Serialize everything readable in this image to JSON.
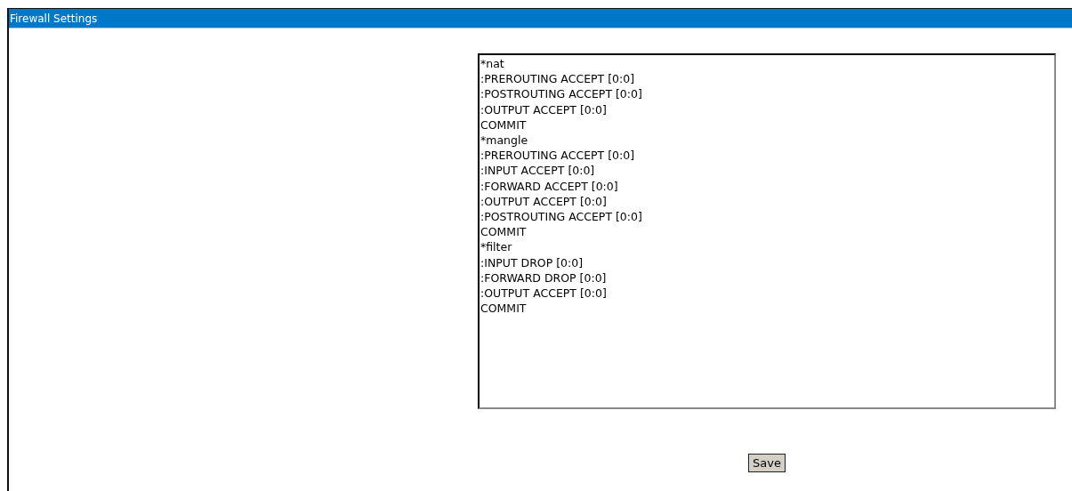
{
  "panel": {
    "title": "Firewall Settings"
  },
  "rules_editor": {
    "lines": [
      "*nat",
      ":PREROUTING ACCEPT [0:0]",
      ":POSTROUTING ACCEPT [0:0]",
      ":OUTPUT ACCEPT [0:0]",
      "COMMIT",
      "*mangle",
      ":PREROUTING ACCEPT [0:0]",
      ":INPUT ACCEPT [0:0]",
      ":FORWARD ACCEPT [0:0]",
      ":OUTPUT ACCEPT [0:0]",
      ":POSTROUTING ACCEPT [0:0]",
      "COMMIT",
      "*filter",
      ":INPUT DROP [0:0]",
      ":FORWARD DROP [0:0]",
      ":OUTPUT ACCEPT [0:0]",
      "COMMIT"
    ]
  },
  "buttons": [
    "Save"
  ]
}
